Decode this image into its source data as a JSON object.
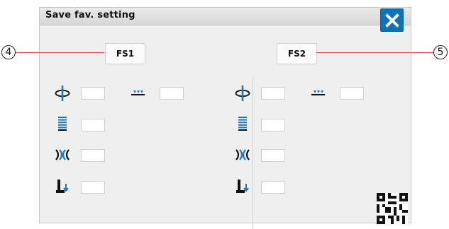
{
  "window": {
    "title": "Save fav. setting"
  },
  "buttons": {
    "fs1": "FS1",
    "fs2": "FS2"
  },
  "callouts": {
    "c4": "4",
    "c5": "5"
  },
  "colors": {
    "accent": "#0e72b4",
    "callout_line": "#d33a4b"
  },
  "icons": {
    "close": "close-icon",
    "thread_tension": "thread-tension-icon",
    "stitch_density": "stitch-density-icon",
    "stitch_width": "stitch-width-icon",
    "presser_foot": "presser-foot-pressure-icon",
    "feed_dogs": "feed-dogs-icon",
    "qr": "qr-code-icon"
  }
}
